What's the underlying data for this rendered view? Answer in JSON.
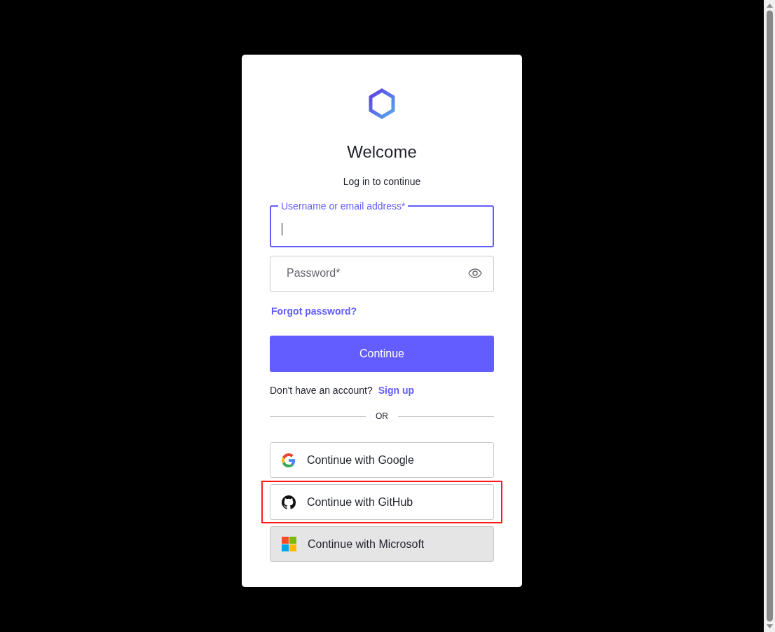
{
  "card": {
    "title": "Welcome",
    "subtitle": "Log in to continue",
    "fields": [
      {
        "kind": "text",
        "label": "Username or email address*",
        "focused": true
      },
      {
        "kind": "password",
        "placeholder": "Password*",
        "focused": false
      }
    ],
    "forgot_link": "Forgot password?",
    "continue_button": "Continue",
    "signup": {
      "text": "Don't have an account?",
      "link": "Sign up"
    },
    "divider": "OR",
    "social_buttons": [
      {
        "kind": "google",
        "label": "Continue with Google",
        "hovered": false,
        "highlighted": false
      },
      {
        "kind": "github",
        "label": "Continue with GitHub",
        "hovered": false,
        "highlighted": true
      },
      {
        "kind": "microsoft",
        "label": "Continue with Microsoft",
        "hovered": true,
        "highlighted": false
      }
    ]
  }
}
